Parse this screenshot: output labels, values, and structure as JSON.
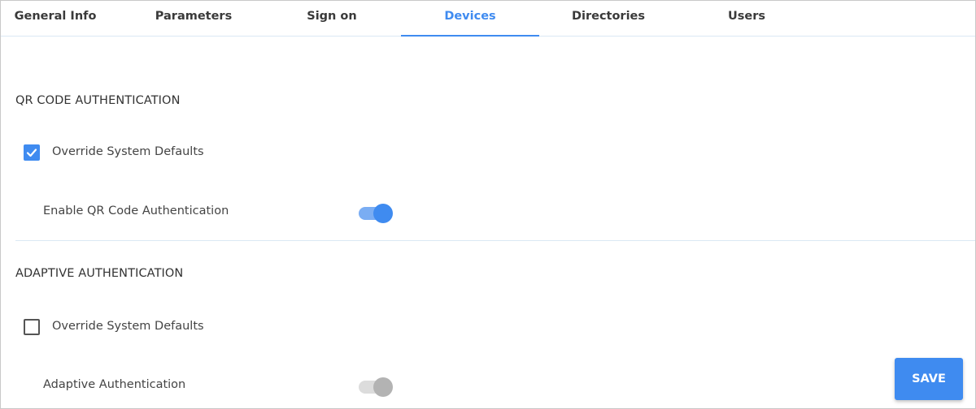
{
  "tabs": [
    {
      "label": "General Info",
      "active": false
    },
    {
      "label": "Parameters",
      "active": false
    },
    {
      "label": "Sign on",
      "active": false
    },
    {
      "label": "Devices",
      "active": true
    },
    {
      "label": "Directories",
      "active": false
    },
    {
      "label": "Users",
      "active": false
    }
  ],
  "qr_section": {
    "title": "QR CODE AUTHENTICATION",
    "override_label": "Override System Defaults",
    "override_checked": true,
    "toggle_label": "Enable QR Code Authentication",
    "toggle_on": true
  },
  "adaptive_section": {
    "title": "ADAPTIVE AUTHENTICATION",
    "override_label": "Override System Defaults",
    "override_checked": false,
    "toggle_label": "Adaptive Authentication",
    "toggle_on": false
  },
  "save_label": "SAVE",
  "colors": {
    "accent": "#3f8bf0",
    "accent_light": "#7aadf3",
    "toggle_off_track": "#dcdcdc",
    "toggle_off_thumb": "#b3b3b3"
  },
  "icons": {
    "checkbox_checked": "check-icon"
  }
}
